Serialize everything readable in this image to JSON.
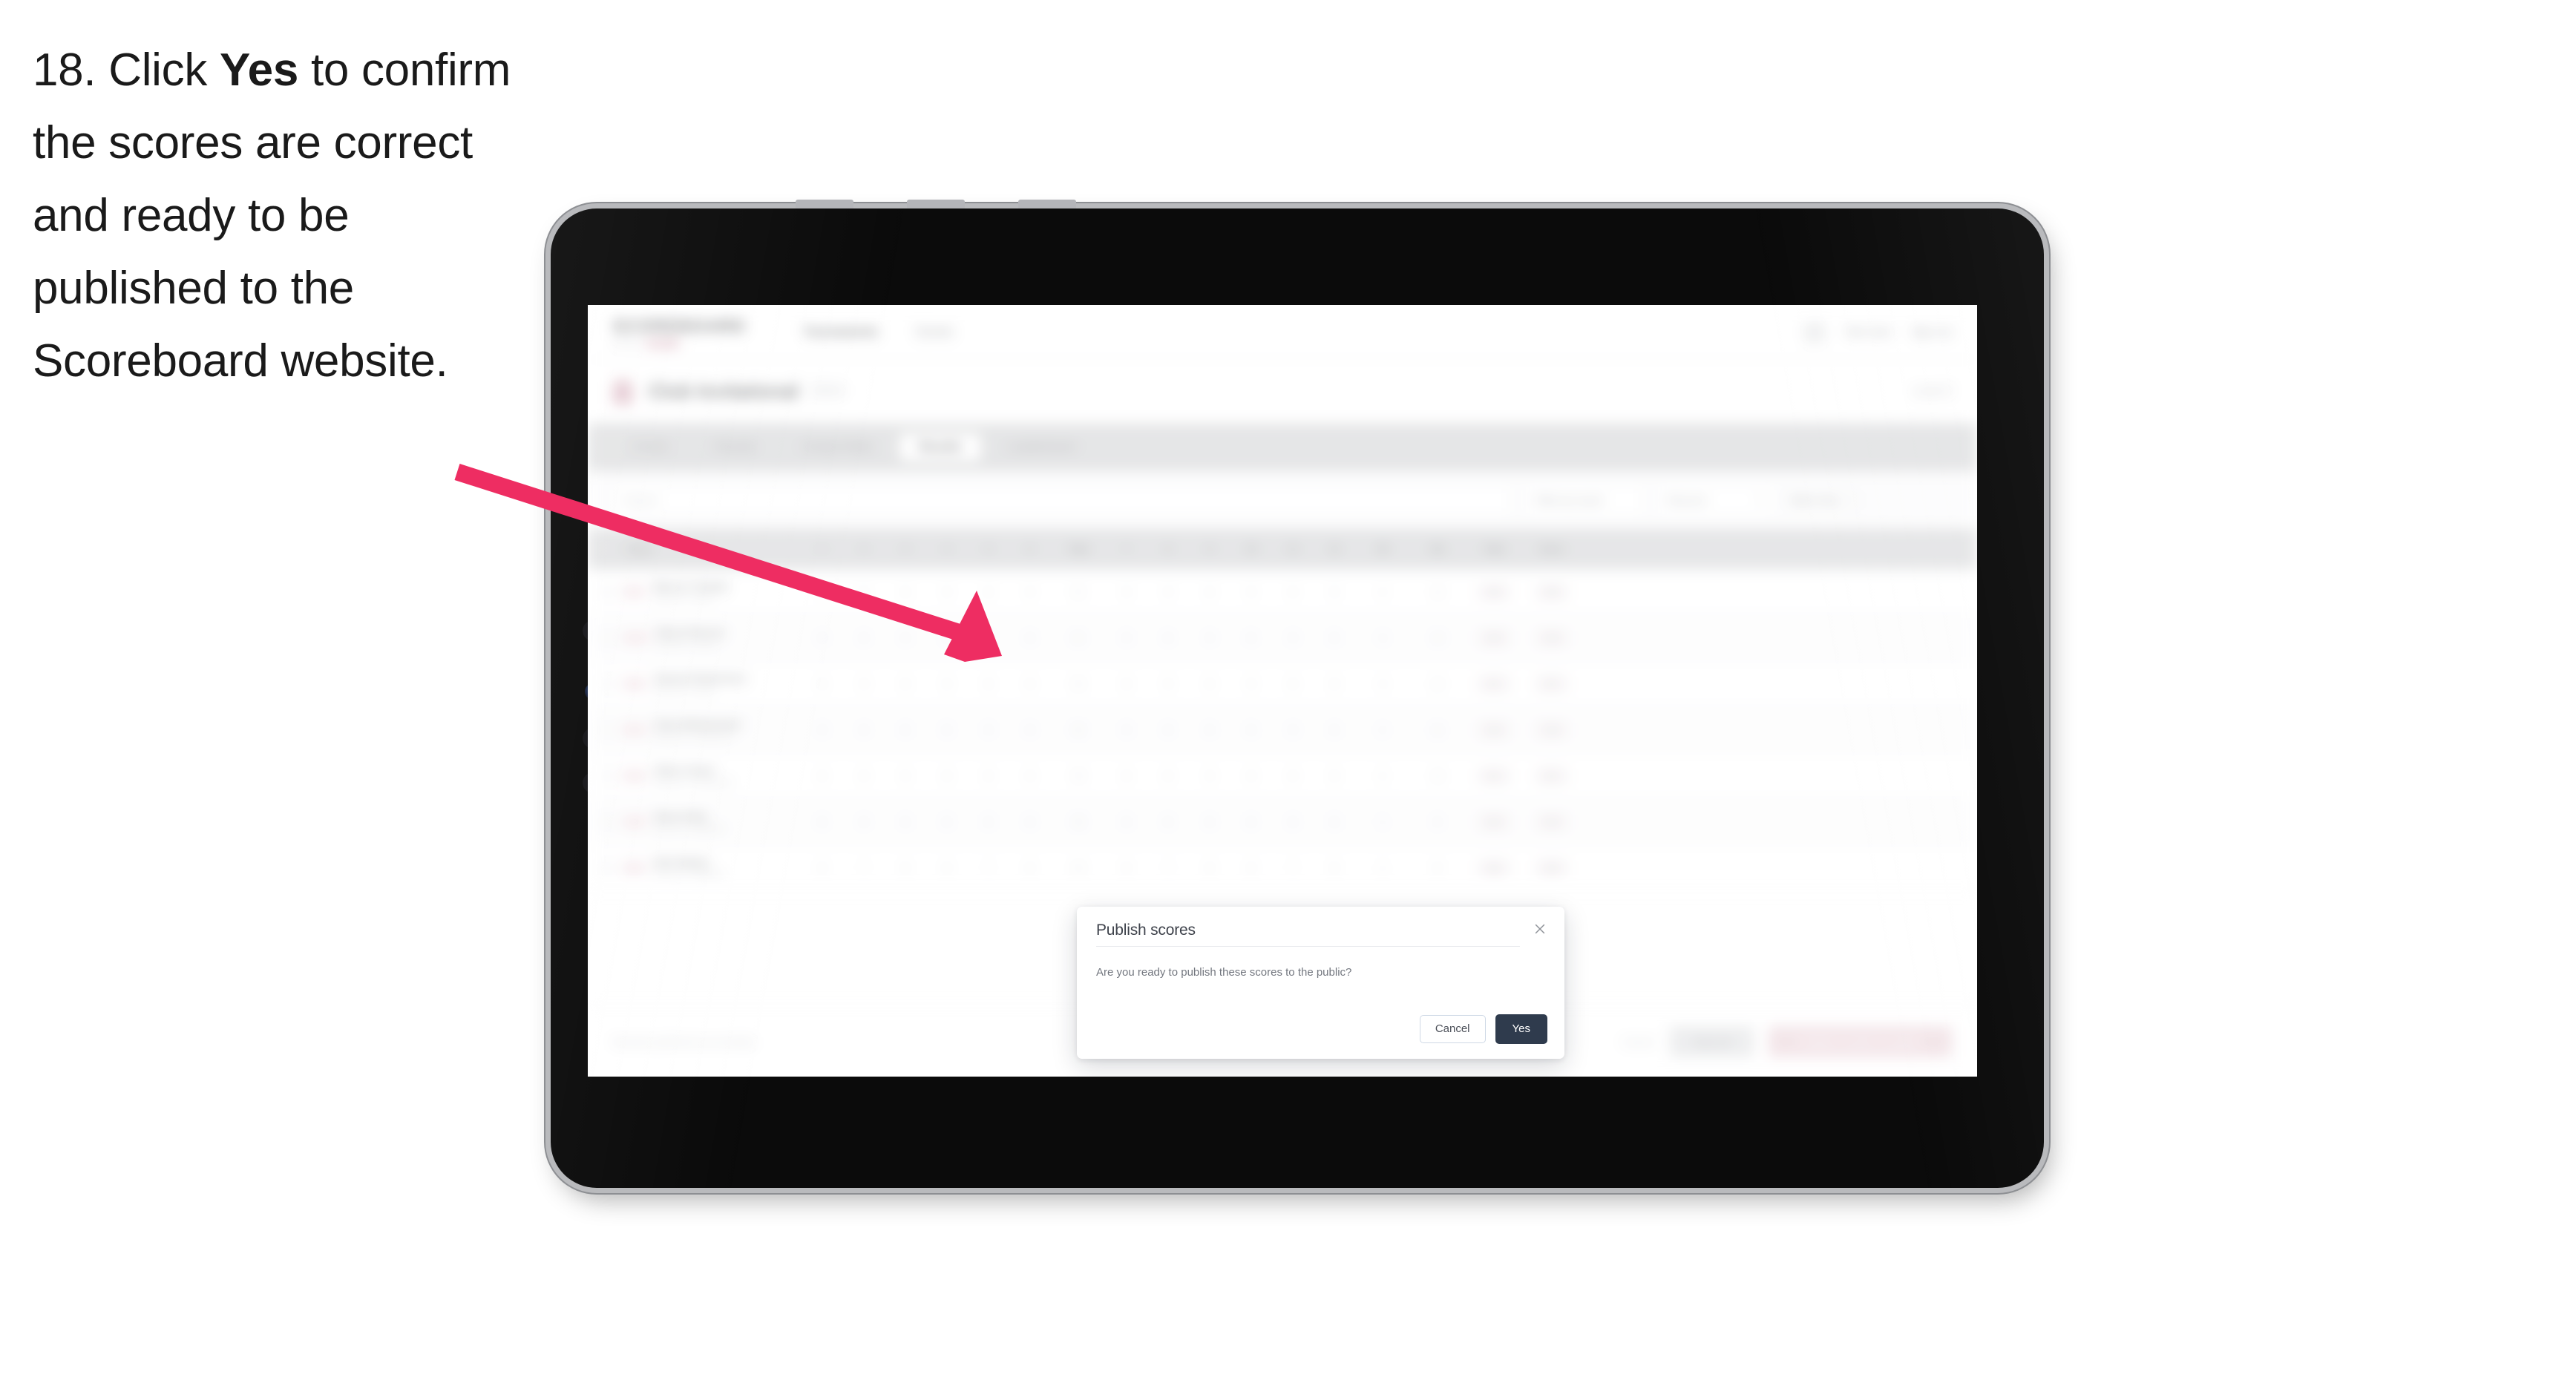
{
  "instruction": {
    "number": "18.",
    "pre": "Click",
    "emphasis": "Yes",
    "post": "to confirm the scores are correct and ready to be published to the Scoreboard website."
  },
  "colors": {
    "arrow": "#ee2d62",
    "primary_button": "#2f3b4d",
    "accent_pink": "#f06292",
    "device_frame": "#0b0b0b",
    "device_rim": "#b9babd"
  },
  "device": {
    "type": "tablet",
    "orientation": "landscape"
  },
  "app": {
    "topnav": {
      "brand_name": "SCOREBOARD",
      "brand_sub": "Archery",
      "brand_pill": "BETA",
      "links": [
        {
          "label": "Tournaments",
          "active": true
        },
        {
          "label": "Events",
          "active": false
        }
      ],
      "user_name": "Test User",
      "signout_label": "Sign out"
    },
    "subheader": {
      "title": "Club Invitational",
      "chip": "2024",
      "right_label": "Level 2"
    },
    "tabs": [
      {
        "label": "Details",
        "active": false
      },
      {
        "label": "Rounds",
        "active": false
      },
      {
        "label": "Compe Mode",
        "active": false
      },
      {
        "label": "Results",
        "active": true
      },
      {
        "label": "Leaderboard",
        "active": false
      }
    ],
    "filters": {
      "search_placeholder": "Search",
      "field_one": "Filter by round",
      "field_two": "Recurve",
      "link_label": "Table Only"
    },
    "table": {
      "headers": [
        "Player",
        "1",
        "2",
        "3",
        "4",
        "5",
        "6",
        "Total",
        "7",
        "8",
        "9",
        "10",
        "11",
        "12",
        "XS",
        "10s",
        "Total",
        "Score"
      ],
      "rows": [
        {
          "rank": "1st",
          "name": "Marcus Tanaka",
          "sub": "Recurve • Senior",
          "scores": [
            "9",
            "9",
            "8",
            "9",
            "8",
            "9"
          ],
          "total": "52",
          "xs": "4",
          "tens": "16",
          "final": "546",
          "score": "546"
        },
        {
          "rank": "2nd",
          "name": "Elena Petrova",
          "sub": "Recurve • Senior",
          "scores": [
            "9",
            "8",
            "9",
            "8",
            "9",
            "8"
          ],
          "total": "51",
          "xs": "3",
          "tens": "14",
          "final": "538",
          "score": "538"
        },
        {
          "rank": "3rd",
          "name": "Samuel Robertson",
          "sub": "Recurve • Senior",
          "scores": [
            "8",
            "9",
            "8",
            "9",
            "8",
            "8"
          ],
          "total": "50",
          "xs": "3",
          "tens": "12",
          "final": "527",
          "score": "527"
        },
        {
          "rank": "4th",
          "name": "Clara Mohammed",
          "sub": "Recurve • Compound",
          "scores": [
            "9",
            "8",
            "8",
            "8",
            "9",
            "8"
          ],
          "total": "50",
          "xs": "2",
          "tens": "11",
          "final": "519",
          "score": "519"
        },
        {
          "rank": "5th",
          "name": "Oliver Grant",
          "sub": "Recurve • Compound",
          "scores": [
            "8",
            "8",
            "9",
            "8",
            "8",
            "8"
          ],
          "total": "49",
          "xs": "2",
          "tens": "10",
          "final": "511",
          "score": "511"
        },
        {
          "rank": "6th",
          "name": "Dana Kelly",
          "sub": "Recurve • Barebow",
          "scores": [
            "8",
            "8",
            "8",
            "8",
            "8",
            "8"
          ],
          "total": "48",
          "xs": "1",
          "tens": "9",
          "final": "503",
          "score": "503"
        },
        {
          "rank": "7th",
          "name": "Nick Bailey",
          "sub": "Recurve • Barebow",
          "scores": [
            "8",
            "7",
            "8",
            "8",
            "7",
            "8"
          ],
          "total": "46",
          "xs": "1",
          "tens": "8",
          "final": "492",
          "score": "492"
        }
      ]
    },
    "footer": {
      "note": "Results published successfully",
      "link": "Cancel",
      "secondary_button": "Save all",
      "primary_button": "Publish results to public"
    }
  },
  "dialog": {
    "title": "Publish scores",
    "message": "Are you ready to publish these scores to the public?",
    "cancel_label": "Cancel",
    "confirm_label": "Yes",
    "close_icon": "close-icon"
  }
}
